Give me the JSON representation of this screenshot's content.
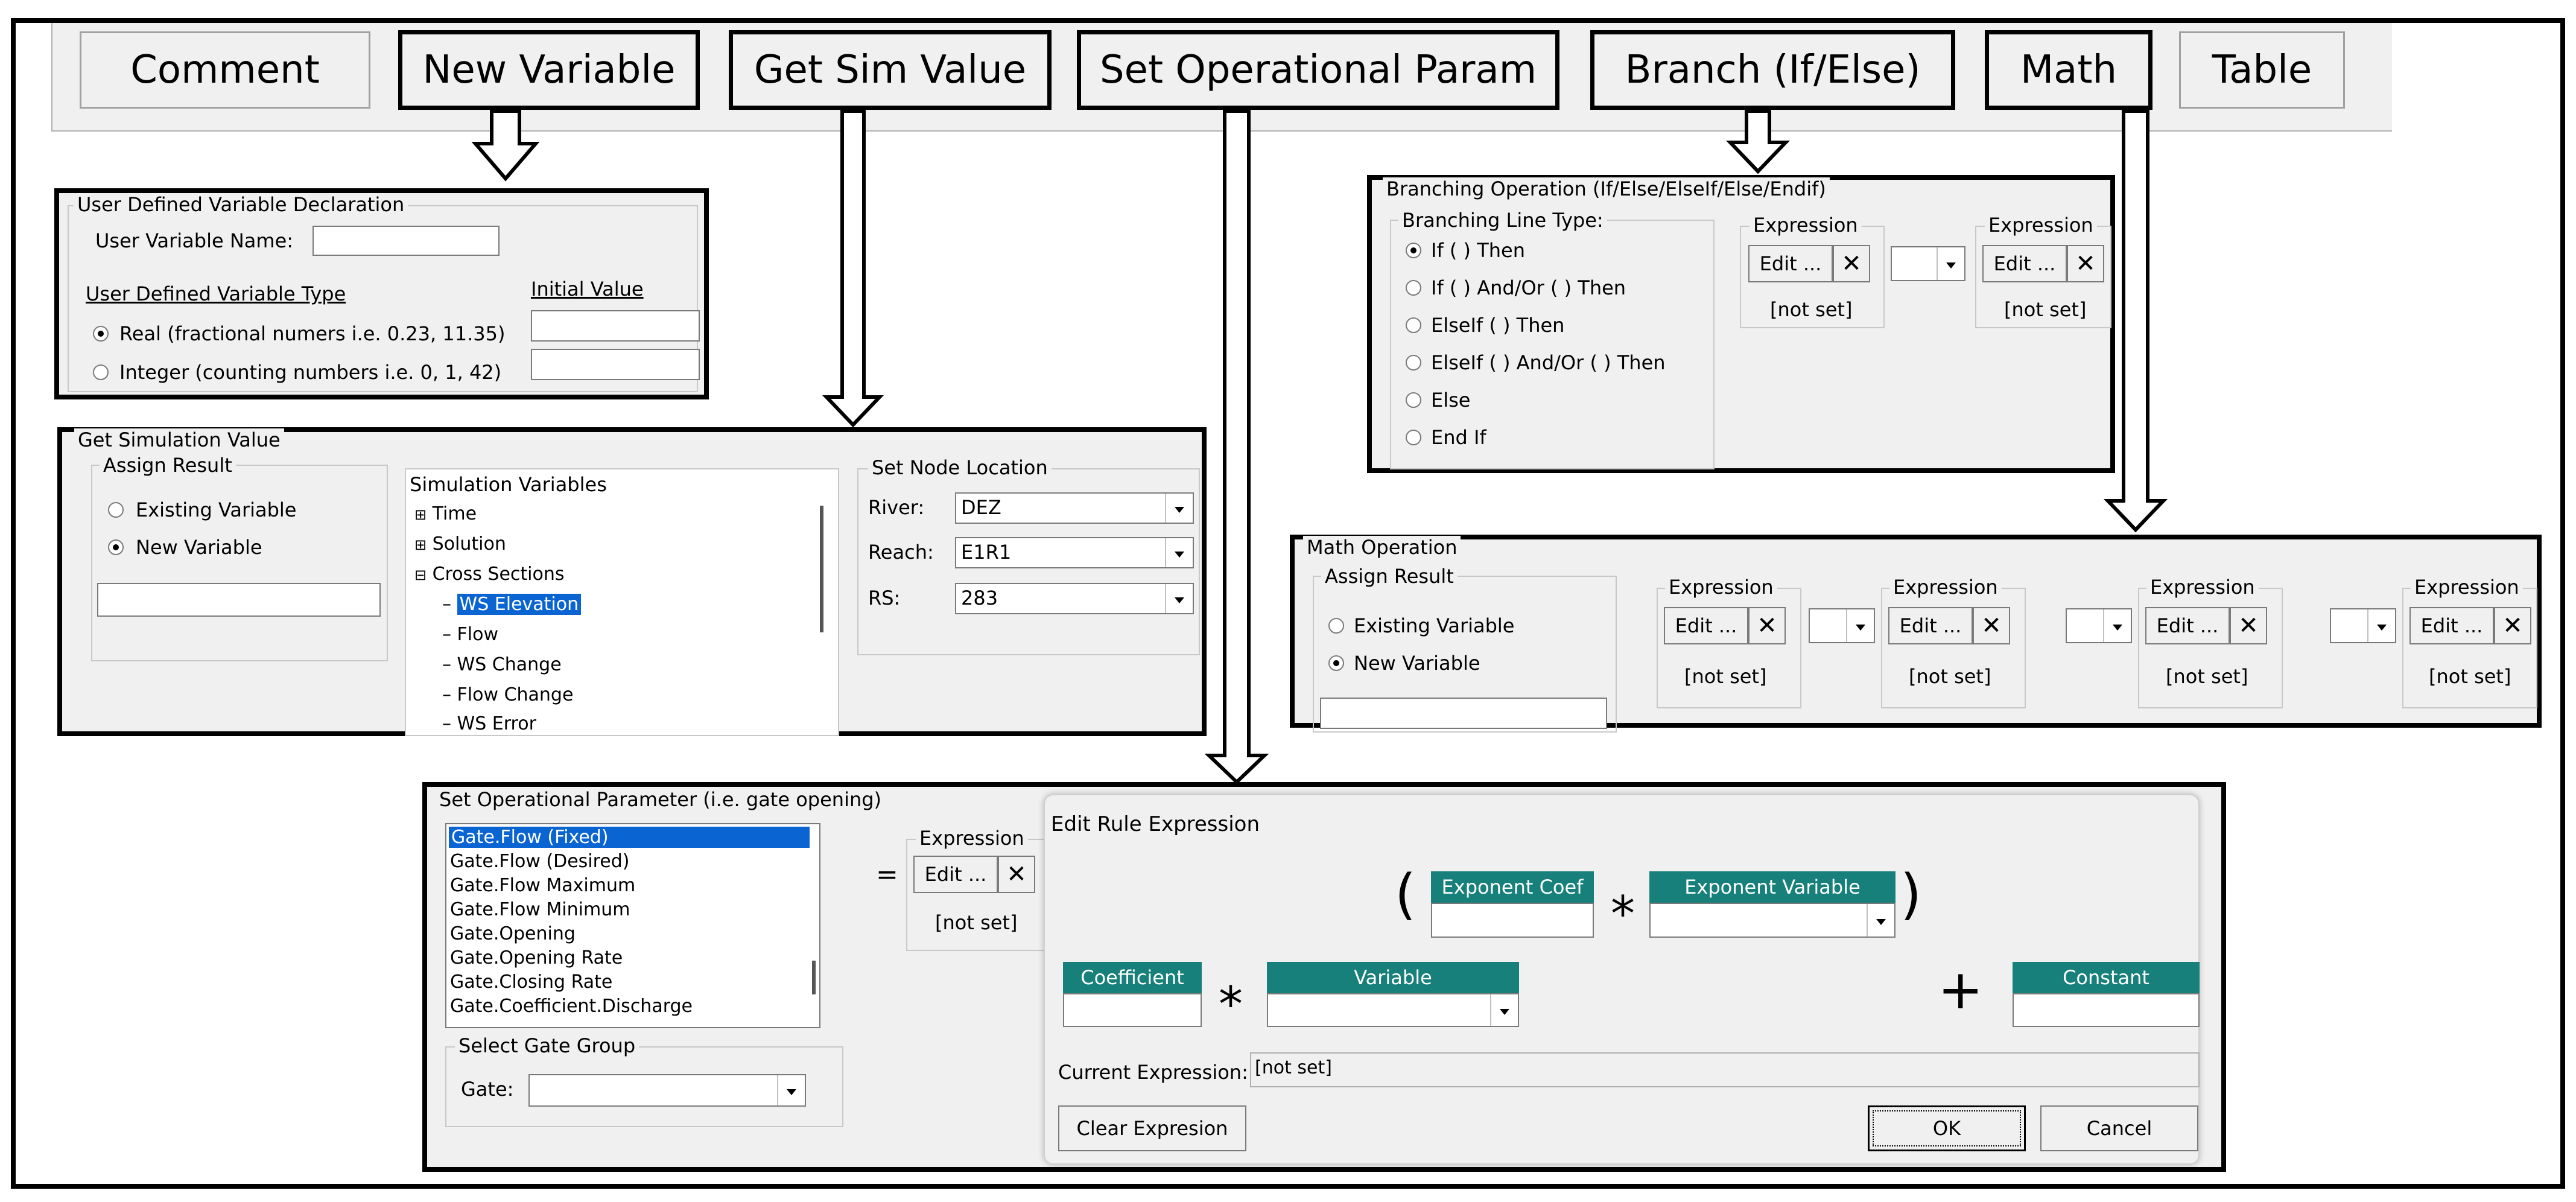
{
  "toolbar": {
    "buttons": [
      "Comment",
      "New Variable",
      "Get Sim Value",
      "Set Operational Param",
      "Branch (If/Else)",
      "Math",
      "Table"
    ]
  },
  "new_variable": {
    "group_label": "User Defined Variable Declaration",
    "name_label": "User Variable Name:",
    "type_label": "User Defined Variable Type",
    "initial_value_label": "Initial Value",
    "options": [
      "Real (fractional numers i.e. 0.23, 11.35)",
      "Integer (counting numbers i.e.  0, 1, 42)"
    ],
    "selected_option": 0
  },
  "get_sim": {
    "title": "Get Simulation Value",
    "assign_label": "Assign Result",
    "options": [
      "Existing Variable",
      "New Variable"
    ],
    "tree_header": "Simulation Variables",
    "tree_nodes": [
      "Time",
      "Solution",
      "Cross Sections"
    ],
    "tree_leaves": [
      "WS Elevation",
      "Flow",
      "WS Change",
      "Flow Change",
      "WS Error"
    ],
    "node_group": "Set Node Location",
    "fields": [
      {
        "label": "River:",
        "value": "DEZ"
      },
      {
        "label": "Reach:",
        "value": "E1R1"
      },
      {
        "label": "RS:",
        "value": "283"
      }
    ]
  },
  "branch": {
    "title": "Branching Operation (If/Else/ElseIf/Else/Endif)",
    "type_label": "Branching Line Type:",
    "options": [
      "If  (  )  Then",
      "If  (  )  And/Or  (  )  Then",
      "ElseIf  (  )  Then",
      "ElseIf  (  )  And/Or  (  )  Then",
      "Else",
      "End If"
    ],
    "expression_label": "Expression",
    "edit_label": "Edit ...",
    "not_set": "[not set]"
  },
  "math": {
    "title": "Math Operation",
    "assign_label": "Assign Result",
    "options": [
      "Existing Variable",
      "New Variable"
    ],
    "expression_label": "Expression",
    "edit_label": "Edit ...",
    "not_set": "[not set]"
  },
  "set_op": {
    "title": "Set Operational Parameter (i.e. gate opening)",
    "params": [
      "Gate.Flow (Fixed)",
      "Gate.Flow (Desired)",
      "Gate.Flow Maximum",
      "Gate.Flow Minimum",
      "Gate.Opening",
      "Gate.Opening Rate",
      "Gate.Closing Rate",
      "Gate.Coefficient.Discharge"
    ],
    "gate_group": "Select Gate Group",
    "gate_label": "Gate:",
    "equals": "=",
    "expression_label": "Expression",
    "edit_label": "Edit ...",
    "not_set": "[not set]"
  },
  "edit_rule": {
    "title": "Edit Rule Expression",
    "exp_coef": "Exponent Coef",
    "exp_var": "Exponent Variable",
    "coefficient": "Coefficient",
    "variable": "Variable",
    "constant": "Constant",
    "open_paren": "(",
    "close_paren": ")",
    "times": "*",
    "plus": "+",
    "current_label": "Current Expression:",
    "current_value": "[not set]",
    "clear_button": "Clear Expresion",
    "ok_button": "OK",
    "cancel_button": "Cancel"
  },
  "colors": {
    "header_teal": "#17807a",
    "selection_blue": "#0a64d2",
    "dialog_bg": "#f0f0f0"
  }
}
